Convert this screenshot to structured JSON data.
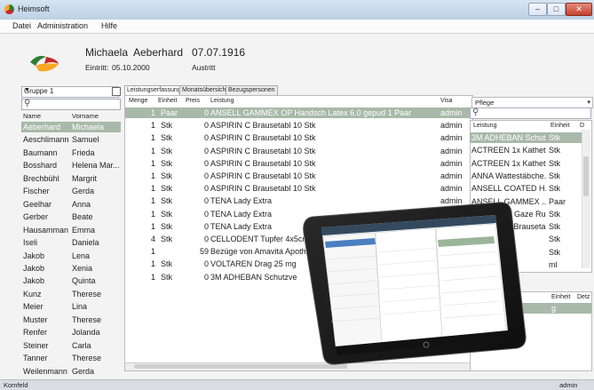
{
  "window": {
    "title": "Heimsoft"
  },
  "menu": [
    "Datei",
    "Administration",
    "Hilfe"
  ],
  "patient": {
    "first_name": "Michaela",
    "last_name": "Aeberhard",
    "birth_date": "07.07.1916",
    "entry_label": "Eintritt:",
    "entry_date": "05.10.2000",
    "exit_label": "Austritt"
  },
  "left_panel": {
    "group_selected": "Gruppe 1",
    "headers": {
      "name": "Name",
      "first": "Vorname"
    },
    "rows": [
      {
        "name": "Aeberhard",
        "first": "Michaela"
      },
      {
        "name": "Aeschlimann",
        "first": "Samuel"
      },
      {
        "name": "Baumann",
        "first": "Frieda"
      },
      {
        "name": "Bosshard",
        "first": "Helena Mar..."
      },
      {
        "name": "Brechbühl",
        "first": "Margrit"
      },
      {
        "name": "Fischer",
        "first": "Gerda"
      },
      {
        "name": "Geelhar",
        "first": "Anna"
      },
      {
        "name": "Gerber",
        "first": "Beate"
      },
      {
        "name": "Hausamman",
        "first": "Emma"
      },
      {
        "name": "Iseli",
        "first": "Daniela"
      },
      {
        "name": "Jakob",
        "first": "Lena"
      },
      {
        "name": "Jakob",
        "first": "Xenia"
      },
      {
        "name": "Jakob",
        "first": "Quinta"
      },
      {
        "name": "Kunz",
        "first": "Therese"
      },
      {
        "name": "Meier",
        "first": "Lina"
      },
      {
        "name": "Muster",
        "first": "Therese"
      },
      {
        "name": "Renfer",
        "first": "Jolanda"
      },
      {
        "name": "Steiner",
        "first": "Carla"
      },
      {
        "name": "Tanner",
        "first": "Therese"
      },
      {
        "name": "Weilenmann",
        "first": "Gerda"
      }
    ]
  },
  "tabs": [
    "Leistungserfassung",
    "Monatsübersicht",
    "Bezugspersonen"
  ],
  "main_table": {
    "headers": {
      "menge": "Menge",
      "einheit": "Einheit",
      "preis": "Preis",
      "leistung": "Leistung",
      "visa": "Visa"
    },
    "rows": [
      {
        "menge": "1",
        "einheit": "Paar",
        "preis": "0",
        "leistung": "ANSELL GAMMEX OP Handsch Latex 6.0 gepud 1 Paar",
        "visa": "admin"
      },
      {
        "menge": "1",
        "einheit": "Stk",
        "preis": "0",
        "leistung": "ASPIRIN C Brausetabl 10 Stk",
        "visa": "admin"
      },
      {
        "menge": "1",
        "einheit": "Stk",
        "preis": "0",
        "leistung": "ASPIRIN C Brausetabl 10 Stk",
        "visa": "admin"
      },
      {
        "menge": "1",
        "einheit": "Stk",
        "preis": "0",
        "leistung": "ASPIRIN C Brausetabl 10 Stk",
        "visa": "admin"
      },
      {
        "menge": "1",
        "einheit": "Stk",
        "preis": "0",
        "leistung": "ASPIRIN C Brausetabl 10 Stk",
        "visa": "admin"
      },
      {
        "menge": "1",
        "einheit": "Stk",
        "preis": "0",
        "leistung": "ASPIRIN C Brausetabl 10 Stk",
        "visa": "admin"
      },
      {
        "menge": "1",
        "einheit": "Stk",
        "preis": "0",
        "leistung": "ASPIRIN C Brausetabl 10 Stk",
        "visa": "admin"
      },
      {
        "menge": "1",
        "einheit": "Stk",
        "preis": "0",
        "leistung": "TENA Lady Extra",
        "visa": "admin"
      },
      {
        "menge": "1",
        "einheit": "Stk",
        "preis": "0",
        "leistung": "TENA Lady Extra",
        "visa": "admin"
      },
      {
        "menge": "1",
        "einheit": "Stk",
        "preis": "0",
        "leistung": "TENA Lady Extra",
        "visa": "admin"
      },
      {
        "menge": "4",
        "einheit": "Stk",
        "preis": "0",
        "leistung": "CELLODENT Tupfer 4x5cm",
        "visa": ""
      },
      {
        "menge": "1",
        "einheit": "",
        "preis": "59",
        "leistung": "Bezüge von Amavita Apoth",
        "visa": ""
      },
      {
        "menge": "1",
        "einheit": "Stk",
        "preis": "0",
        "leistung": "VOLTAREN Drag 25 mg",
        "visa": ""
      },
      {
        "menge": "1",
        "einheit": "Stk",
        "preis": "0",
        "leistung": "3M ADHEBAN Schutzve",
        "visa": ""
      }
    ]
  },
  "right_panel": {
    "category": "Pflege",
    "headers": {
      "leistung": "Leistung",
      "einheit": "Einheit",
      "d": "D"
    },
    "rows": [
      {
        "leistung": "3M ADHEBAN Schut...",
        "einheit": "Stk"
      },
      {
        "leistung": "ACTREEN 1x Kathet...",
        "einheit": "Stk"
      },
      {
        "leistung": "ACTREEN 1x Kathet...",
        "einheit": "Stk"
      },
      {
        "leistung": "ANNA Wattestäbche...",
        "einheit": "Stk"
      },
      {
        "leistung": "ANSELL COATED H...",
        "einheit": "Stk"
      },
      {
        "leistung": "ANSELL GAMMEX ...",
        "einheit": "Paar"
      },
      {
        "leistung": "APPLIMED Gaze Ru...",
        "einheit": "Stk"
      },
      {
        "leistung": "ASPIRIN C Brauseta...",
        "einheit": "Stk"
      },
      {
        "leistung": "",
        "einheit": "Stk"
      },
      {
        "leistung": "",
        "einheit": "Stk"
      },
      {
        "leistung": "",
        "einheit": "ml"
      }
    ],
    "lower_headers": {
      "einheit": "Einheit",
      "detail": "Detz"
    },
    "lower_row": {
      "einheit": "g"
    }
  },
  "status": {
    "left": "Komfeld",
    "right": "admin"
  },
  "colors": {
    "selection": "#a9b9a9",
    "titlebar": "#c8d8ea",
    "accent_green": "#7aa37a"
  }
}
